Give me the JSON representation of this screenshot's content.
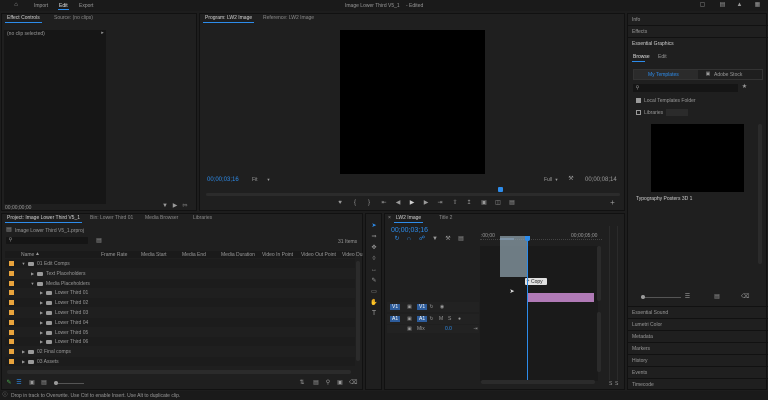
{
  "topbar": {
    "nav": [
      "Import",
      "Edit",
      "Export"
    ],
    "active_nav": "Edit",
    "title": "Image Lower Third V5_1",
    "edited": "- Edited"
  },
  "effect_controls": {
    "tabs": [
      "Effect Controls",
      "Source: (no clips)"
    ],
    "no_clip": "(no clip selected)",
    "timecode": "00;00;00;00"
  },
  "program_monitor": {
    "tabs": [
      "Program: LW2 Image",
      "Reference: LW2 Image"
    ],
    "timecode_left": "00;00;03;16",
    "fit": "Fit",
    "quality": "Full",
    "timecode_right": "00;00;08;14"
  },
  "project": {
    "tabs": [
      "Project: Image Lower Third V5_1",
      "Bin: Lower Third 01",
      "Media Browser",
      "Libraries"
    ],
    "path": "Image Lower Third V5_1.prproj",
    "items_count": "31 Items",
    "columns": [
      "Name",
      "Frame Rate",
      "Media Start",
      "Media End",
      "Media Duration",
      "Video In Point",
      "Video Out Point",
      "Video Du"
    ],
    "rows": [
      {
        "name": "01 Edit Comps",
        "level": 0,
        "color": "#e8a33c",
        "type": "bin",
        "open": true
      },
      {
        "name": "Text Placeholders",
        "level": 1,
        "color": "#e8a33c",
        "type": "bin",
        "open": false
      },
      {
        "name": "Media Placeholders",
        "level": 1,
        "color": "#e8a33c",
        "type": "bin",
        "open": true
      },
      {
        "name": "Lower Third 01",
        "level": 2,
        "color": "#e8a33c",
        "type": "bin",
        "open": false
      },
      {
        "name": "Lower Third 02",
        "level": 2,
        "color": "#e8a33c",
        "type": "bin",
        "open": false
      },
      {
        "name": "Lower Third 03",
        "level": 2,
        "color": "#e8a33c",
        "type": "bin",
        "open": false
      },
      {
        "name": "Lower Third 04",
        "level": 2,
        "color": "#e8a33c",
        "type": "bin",
        "open": false
      },
      {
        "name": "Lower Third 05",
        "level": 2,
        "color": "#e8a33c",
        "type": "bin",
        "open": false
      },
      {
        "name": "Lower Third 06",
        "level": 2,
        "color": "#e8a33c",
        "type": "bin",
        "open": false
      },
      {
        "name": "02 Final comps",
        "level": 0,
        "color": "#e8a33c",
        "type": "bin",
        "open": false
      },
      {
        "name": "03 Assets",
        "level": 0,
        "color": "#e8a33c",
        "type": "bin",
        "open": false
      }
    ]
  },
  "timeline": {
    "tabs": [
      "LW2 Image",
      "Title 2"
    ],
    "timecode": "00;00;03;16",
    "ruler": [
      ":00;00",
      "00;00;05;00"
    ],
    "tracks": [
      "V1",
      "A1"
    ],
    "mix_label": "Mix",
    "mix_value": "0.0",
    "copy_tooltip": "Copy",
    "clip_color": "#b07ab6"
  },
  "right_panel": {
    "info": "Info",
    "effects": "Effects",
    "essential_graphics": "Essential Graphics",
    "tabs": [
      "Browse",
      "Edit"
    ],
    "subtabs": [
      "My Templates",
      "Adobe Stock"
    ],
    "local_templates": "Local Templates Folder",
    "libraries": "Libraries",
    "template_name": "Typography Posters 3D 1",
    "list": [
      "Essential Sound",
      "Lumetri Color",
      "Metadata",
      "Markers",
      "History",
      "Events",
      "Timecode"
    ]
  },
  "status_bar": {
    "text": "Drop in track to Overwrite. Use Ctrl to enable Insert. Use Alt to duplicate clip."
  }
}
